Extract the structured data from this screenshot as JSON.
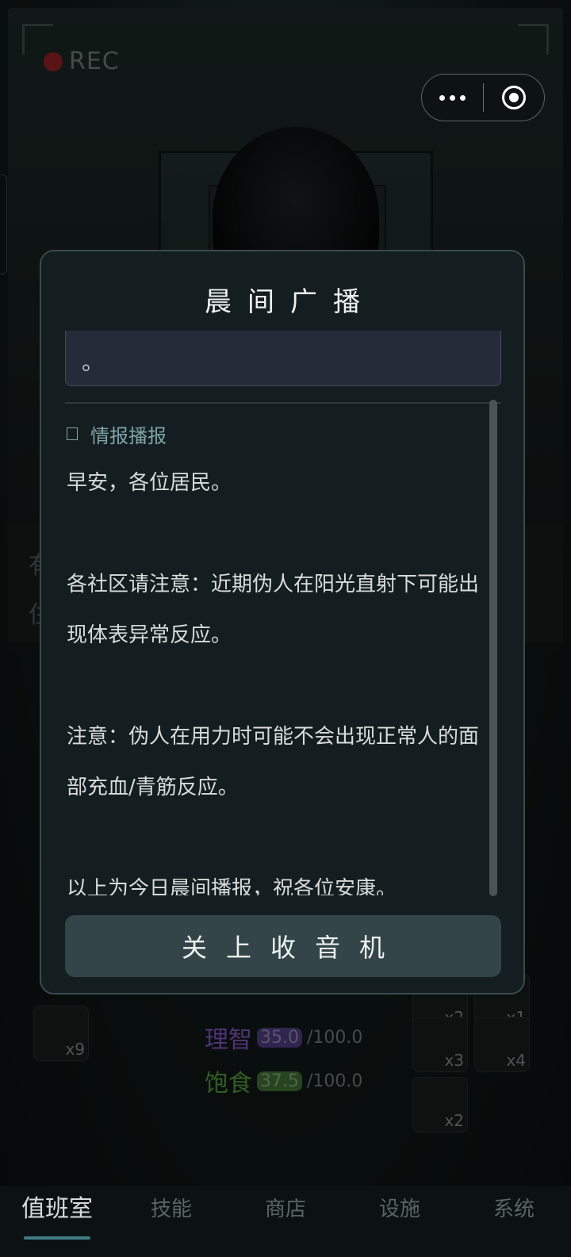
{
  "camera": {
    "rec_label": "REC"
  },
  "background_hint": {
    "line1": "有",
    "line2": "住"
  },
  "stats": [
    {
      "name": "理智",
      "value": "35.0",
      "max": "/100.0",
      "color": "#7b4fb3",
      "pill": "#4b3a7a"
    },
    {
      "name": "饱食",
      "value": "37.5",
      "max": "/100.0",
      "color": "#4f8f3a",
      "pill": "#3b6a2e"
    }
  ],
  "inventory_counts": [
    "x9",
    "x2",
    "x1",
    "x3",
    "x4",
    "x2"
  ],
  "modal": {
    "title": "晨间广播",
    "previous_snippet": "。",
    "section_label": "情报播报",
    "paragraphs": [
      "早安，各位居民。",
      "各社区请注意：近期伪人在阳光直射下可能出现体表异常反应。",
      "注意：伪人在用力时可能不会出现正常人的面部充血/青筋反应。",
      "以上为今日晨间播报，祝各位安康。"
    ],
    "close_button": "关上收音机"
  },
  "nav": {
    "items": [
      {
        "label": "值班室",
        "active": true
      },
      {
        "label": "技能",
        "active": false
      },
      {
        "label": "商店",
        "active": false
      },
      {
        "label": "设施",
        "active": false
      },
      {
        "label": "系统",
        "active": false
      }
    ]
  },
  "colors": {
    "accent": "#3e7c86",
    "modal_bg": "#141d1f",
    "button_bg": "#334548"
  }
}
